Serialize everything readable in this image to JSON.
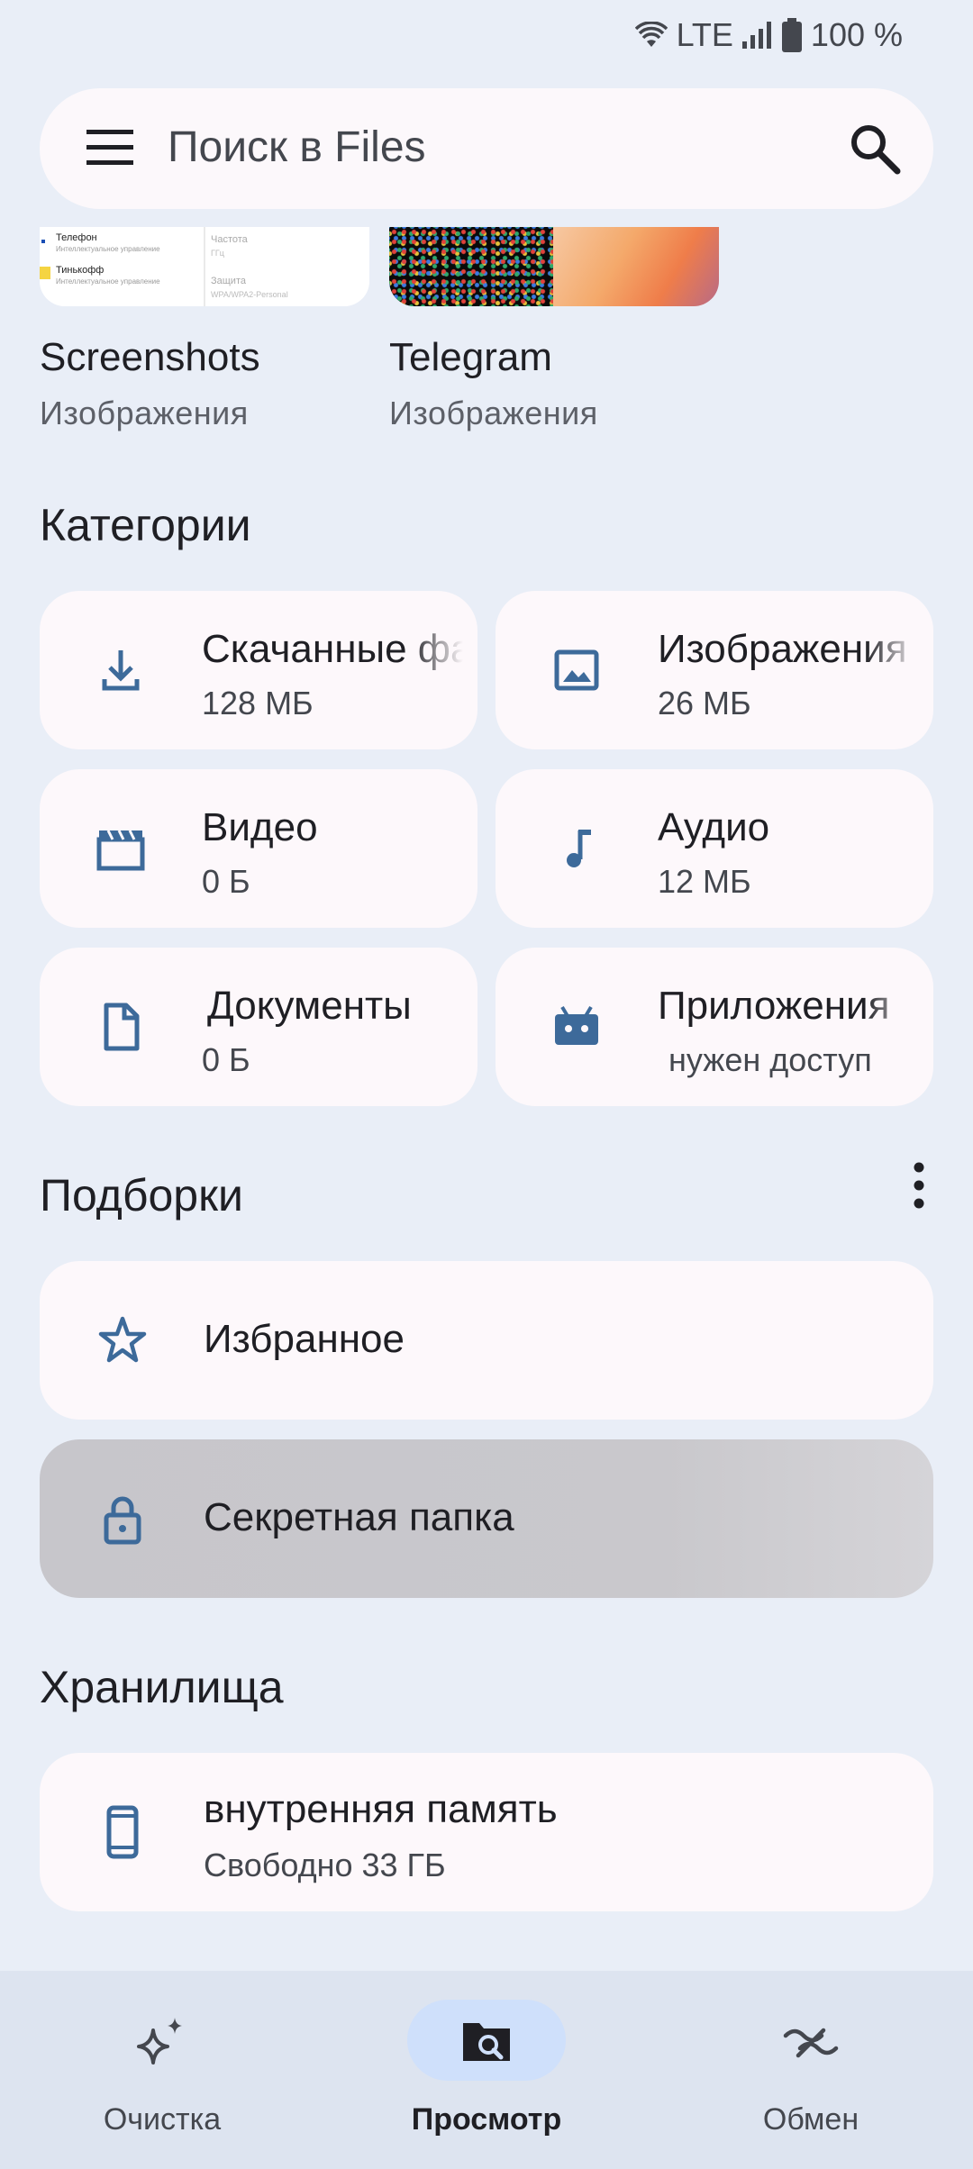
{
  "status": {
    "network": "LTE",
    "battery": "100 %"
  },
  "search": {
    "placeholder": "Поиск в Files"
  },
  "folders": [
    {
      "name": "Screenshots",
      "type": "Изображения"
    },
    {
      "name": "Telegram",
      "type": "Изображения"
    }
  ],
  "screenshot_preview": {
    "line1": "Телефон",
    "line1_sub": "Интеллектуальное управление",
    "line2": "Тинькофф",
    "line2_sub": "Интеллектуальное управление",
    "right1": "Частота",
    "right1_sub": "ГГц",
    "right2": "Защита",
    "right2_sub": "WPA/WPA2-Personal"
  },
  "categories_title": "Категории",
  "categories": [
    {
      "label": "Скачанные файлы",
      "size": "128 МБ",
      "icon": "download-icon"
    },
    {
      "label": "Изображения",
      "size": "26 МБ",
      "icon": "image-icon"
    },
    {
      "label": "Видео",
      "size": "0 Б",
      "icon": "video-icon"
    },
    {
      "label": "Аудио",
      "size": "12 МБ",
      "icon": "music-note-icon"
    },
    {
      "label": "Документы",
      "size": "0 Б",
      "icon": "document-icon"
    },
    {
      "label": "Приложения",
      "size": "нужен доступ",
      "icon": "android-icon"
    }
  ],
  "collections_title": "Подборки",
  "collections": [
    {
      "label": "Избранное",
      "icon": "star-icon"
    },
    {
      "label": "Секретная папка",
      "icon": "lock-icon"
    }
  ],
  "storage_title": "Хранилища",
  "storage": {
    "label": "внутренняя память",
    "free": "Свободно 33 ГБ"
  },
  "nav": [
    {
      "label": "Очистка",
      "icon": "sparkles-icon",
      "active": false
    },
    {
      "label": "Просмотр",
      "icon": "browse-icon",
      "active": true
    },
    {
      "label": "Обмен",
      "icon": "share-icon",
      "active": false
    }
  ],
  "colors": {
    "accent_icon": "#3d6a9a",
    "active_pill": "#cfe0fb"
  }
}
